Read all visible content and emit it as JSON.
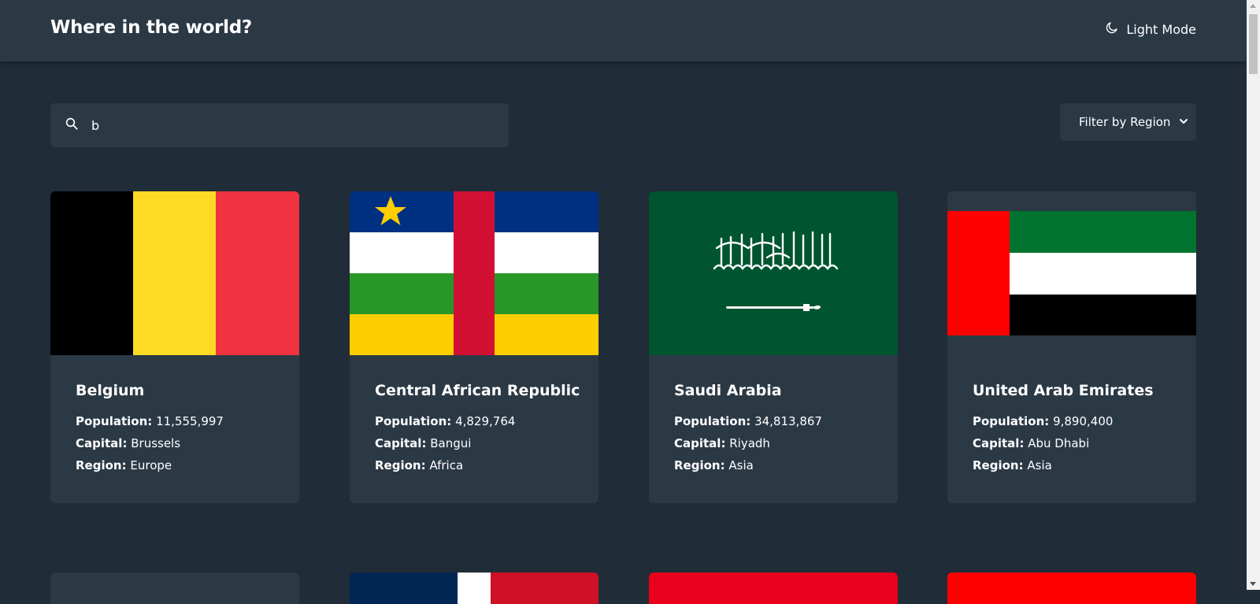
{
  "header": {
    "title": "Where in the world?",
    "mode_label": "Light Mode",
    "mode_icon": "moon-icon"
  },
  "search": {
    "value": "b",
    "icon": "search-icon"
  },
  "filter": {
    "selected": "Filter by Region",
    "icon": "chevron-down-icon"
  },
  "labels": {
    "population": "Population:",
    "capital": "Capital:",
    "region": "Region:"
  },
  "countries": [
    {
      "name": "Belgium",
      "population": "11,555,997",
      "capital": "Brussels",
      "region": "Europe"
    },
    {
      "name": "Central African Republic",
      "population": "4,829,764",
      "capital": "Bangui",
      "region": "Africa"
    },
    {
      "name": "Saudi Arabia",
      "population": "34,813,867",
      "capital": "Riyadh",
      "region": "Asia"
    },
    {
      "name": "United Arab Emirates",
      "population": "9,890,400",
      "capital": "Abu Dhabi",
      "region": "Asia"
    }
  ],
  "colors": {
    "background": "#202c37",
    "element": "#2b3945",
    "text": "#ffffff"
  }
}
